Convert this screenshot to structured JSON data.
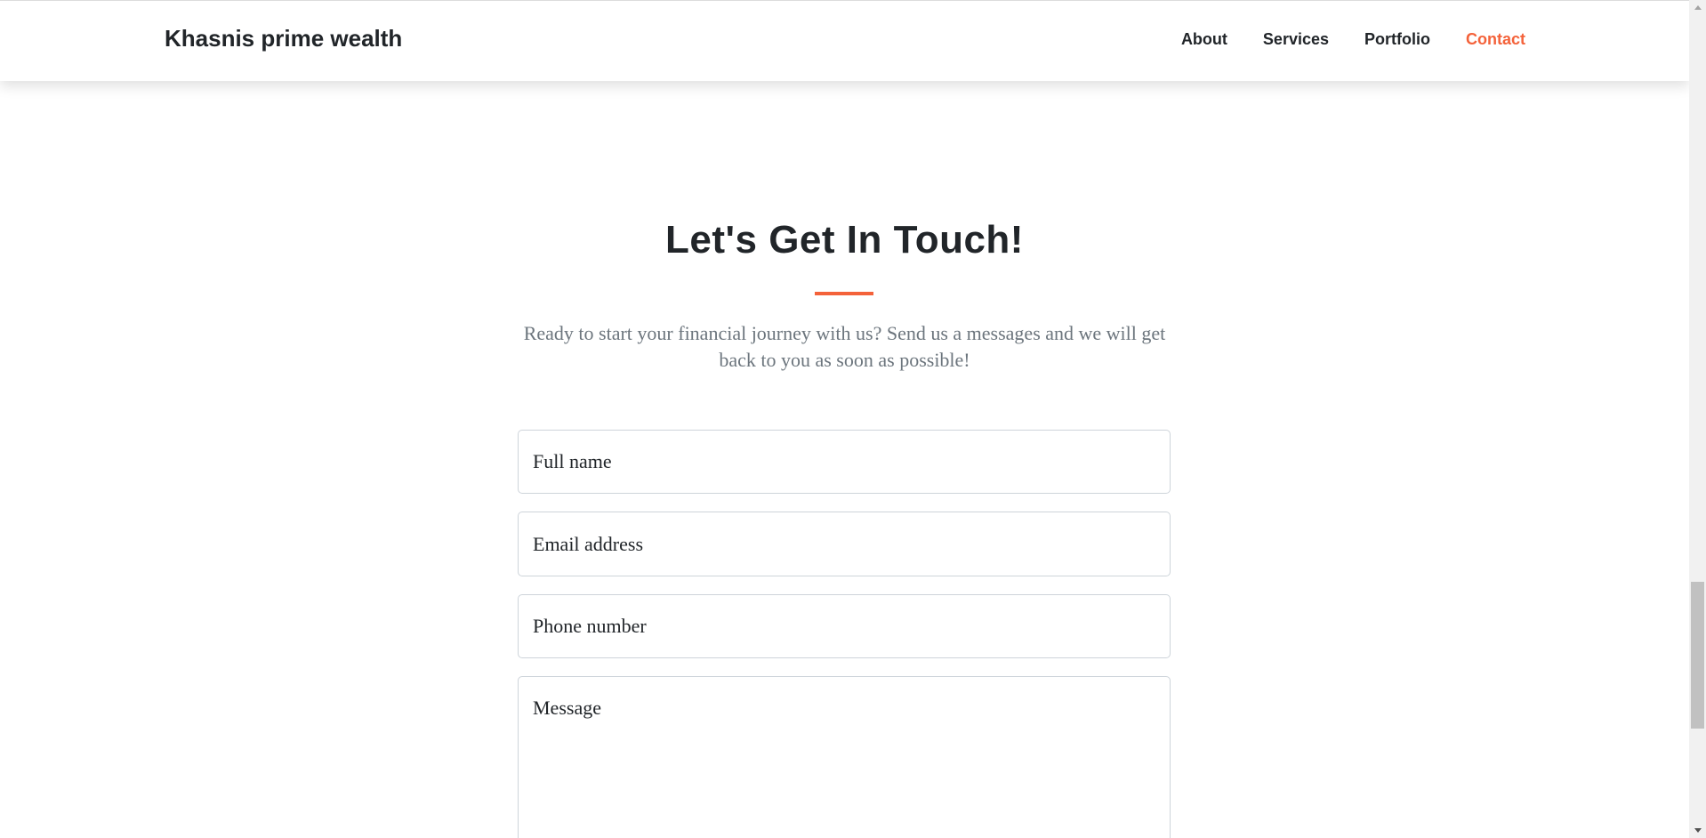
{
  "navbar": {
    "brand": "Khasnis prime wealth",
    "links": [
      {
        "label": "About"
      },
      {
        "label": "Services"
      },
      {
        "label": "Portfolio"
      },
      {
        "label": "Contact",
        "active": true
      }
    ]
  },
  "contact": {
    "heading": "Let's Get In Touch!",
    "lead": "Ready to start your financial journey with us? Send us a messages and we will get back to you as soon as possible!",
    "fields": {
      "name_placeholder": "Full name",
      "email_placeholder": "Email address",
      "phone_placeholder": "Phone number",
      "message_placeholder": "Message"
    }
  },
  "colors": {
    "accent": "#f4623a",
    "text": "#212529",
    "muted": "#6c757d",
    "border": "#ced4da"
  },
  "icons": {
    "scroll_up": "scroll-up-arrow-icon",
    "scroll_down": "scroll-down-arrow-icon"
  }
}
